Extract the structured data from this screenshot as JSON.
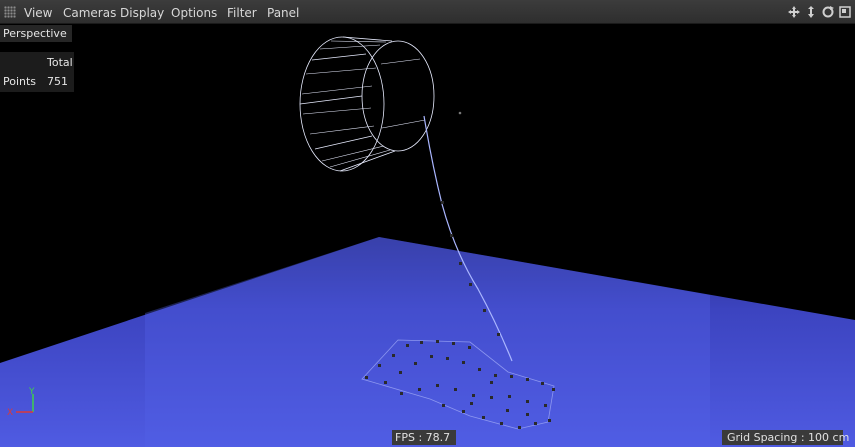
{
  "menubar": {
    "items": [
      {
        "label": "View"
      },
      {
        "label": "Cameras"
      },
      {
        "label": "Display"
      },
      {
        "label": "Options"
      },
      {
        "label": "Filter"
      },
      {
        "label": "Panel"
      }
    ],
    "nav_icons": [
      "move-camera-icon",
      "dolly-camera-icon",
      "rotate-camera-icon",
      "maximize-view-icon"
    ]
  },
  "viewport": {
    "camera_label": "Perspective",
    "stats": {
      "header": "Total",
      "row_label": "Points",
      "row_value": "751"
    },
    "fps": "FPS : 78.7",
    "grid_spacing": "Grid Spacing : 100 cm",
    "axis": {
      "x": "X",
      "y": "Y"
    }
  },
  "colors": {
    "menubar_bg": "#353535",
    "viewport_bg": "#000000",
    "floor_blue": "#4a55d8",
    "wire_white": "#e8ecff",
    "axis_x": "#d93a3a",
    "axis_y": "#3fd04a"
  }
}
